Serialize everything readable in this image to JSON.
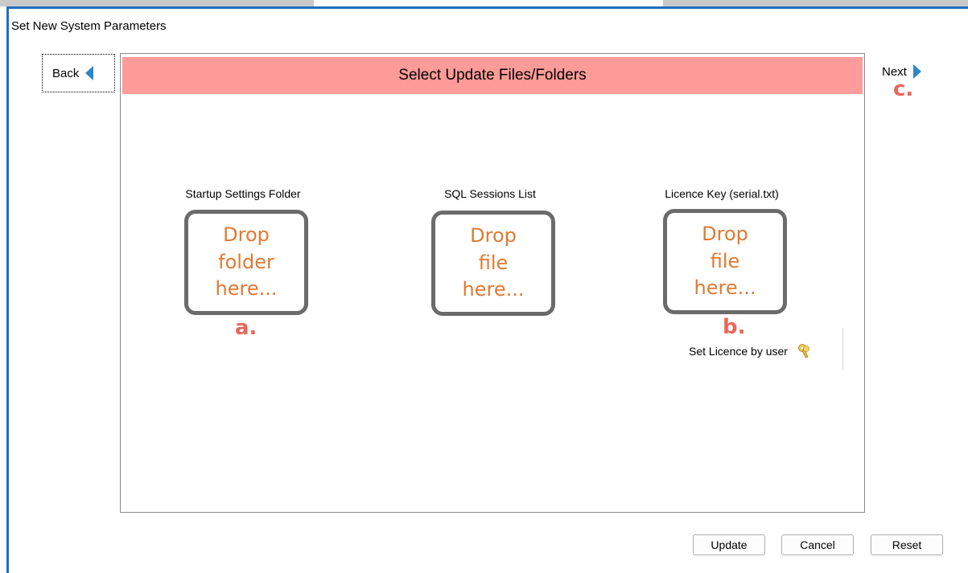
{
  "window": {
    "title": "Set New System Parameters"
  },
  "nav": {
    "back_label": "Back",
    "next_label": "Next",
    "next_annotation": "c."
  },
  "panel": {
    "header": "Select Update Files/Folders"
  },
  "zones": [
    {
      "label": "Startup Settings Folder",
      "drop_lines": [
        "Drop",
        "folder",
        "here..."
      ],
      "annotation": "a."
    },
    {
      "label": "SQL Sessions List",
      "drop_lines": [
        "Drop",
        "file",
        "here..."
      ]
    },
    {
      "label": "Licence Key (serial.txt)",
      "drop_lines": [
        "Drop",
        "file",
        "here..."
      ],
      "annotation": "b."
    }
  ],
  "licence_link": {
    "label": "Set Licence by user",
    "icon": "key-icon"
  },
  "footer": {
    "update_label": "Update",
    "cancel_label": "Cancel",
    "reset_label": "Reset"
  },
  "colors": {
    "header_bg": "#ff9b98",
    "drop_text": "#e07a32",
    "annotation": "#e8675a",
    "accent": "#1f6fbf"
  }
}
